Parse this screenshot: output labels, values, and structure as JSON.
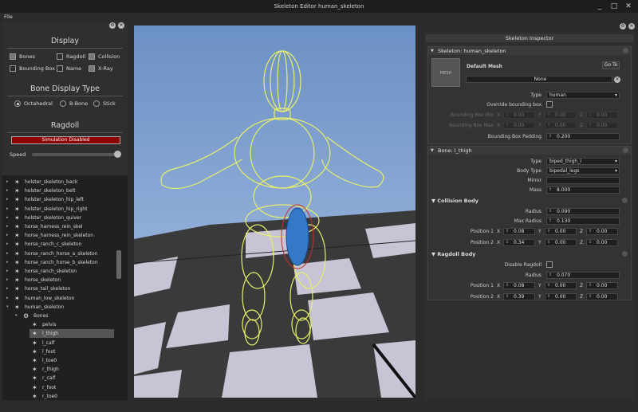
{
  "window": {
    "title": "Skeleton Editor human_skeleton",
    "min": "_",
    "max": "□",
    "close": "✕"
  },
  "menu": {
    "file": "File"
  },
  "display": {
    "heading": "Display",
    "bones": "Bones",
    "ragdoll": "Ragdoll",
    "collision": "Collision",
    "bbox": "Bounding Box",
    "name": "Name",
    "xray": "X-Ray"
  },
  "bone_type": {
    "heading": "Bone Display Type",
    "octahedral": "Octahedral",
    "bbone": "B-Bone",
    "stick": "Stick"
  },
  "ragdoll": {
    "heading": "Ragdoll",
    "sim_button": "Simulation Disabled",
    "speed_label": "Speed",
    "speed_value": 1.0
  },
  "tree": {
    "items": [
      {
        "label": "holster_skeleton_back",
        "depth": 0,
        "exp": "▸"
      },
      {
        "label": "holster_skeleton_belt",
        "depth": 0,
        "exp": "▸"
      },
      {
        "label": "holster_skeleton_hip_left",
        "depth": 0,
        "exp": "▸"
      },
      {
        "label": "holster_skeleton_hip_right",
        "depth": 0,
        "exp": "▸"
      },
      {
        "label": "holster_skeleton_quiver",
        "depth": 0,
        "exp": "▸"
      },
      {
        "label": "horse_harness_rein_skel",
        "depth": 0,
        "exp": "▸"
      },
      {
        "label": "horse_harness_rein_skeleton",
        "depth": 0,
        "exp": "▸"
      },
      {
        "label": "horse_ranch_c_skeleton",
        "depth": 0,
        "exp": "▸"
      },
      {
        "label": "horse_ranch_horse_a_skeleton",
        "depth": 0,
        "exp": "▸"
      },
      {
        "label": "horse_ranch_horse_b_skeleton",
        "depth": 0,
        "exp": "▸"
      },
      {
        "label": "horse_ranch_skeleton",
        "depth": 0,
        "exp": "▸"
      },
      {
        "label": "horse_skeleton",
        "depth": 0,
        "exp": "▸"
      },
      {
        "label": "horse_tail_skeleton",
        "depth": 0,
        "exp": "▸"
      },
      {
        "label": "human_low_skeleton",
        "depth": 0,
        "exp": "▸"
      },
      {
        "label": "human_skeleton",
        "depth": 0,
        "exp": "▾"
      },
      {
        "label": "Bones",
        "depth": 1,
        "exp": "▾"
      },
      {
        "label": "pelvis",
        "depth": 2,
        "exp": ""
      },
      {
        "label": "l_thigh",
        "depth": 2,
        "exp": "",
        "selected": true
      },
      {
        "label": "l_calf",
        "depth": 2,
        "exp": ""
      },
      {
        "label": "l_foot",
        "depth": 2,
        "exp": ""
      },
      {
        "label": "l_toe0",
        "depth": 2,
        "exp": ""
      },
      {
        "label": "r_thigh",
        "depth": 2,
        "exp": ""
      },
      {
        "label": "r_calf",
        "depth": 2,
        "exp": ""
      },
      {
        "label": "r_foot",
        "depth": 2,
        "exp": ""
      },
      {
        "label": "r_toe0",
        "depth": 2,
        "exp": ""
      }
    ]
  },
  "inspector": {
    "title": "Skeleton Inspector",
    "skeleton": {
      "header": "Skeleton: human_skeleton",
      "mesh_label": "Default Mesh",
      "goto": "Go To",
      "thumb": "MESH",
      "none": "None",
      "type_label": "Type",
      "type_value": "human",
      "override_label": "Override bounding box",
      "bbmin_label": "Bounding Box Min",
      "bbmax_label": "Bounding Box Max",
      "bbmin": [
        "0.00",
        "0.00",
        "0.00"
      ],
      "bbmax": [
        "0.00",
        "0.00",
        "0.00"
      ],
      "padding_label": "Bounding Box Padding",
      "padding": "0.200"
    },
    "bone": {
      "header": "Bone: l_thigh",
      "type_label": "Type",
      "type_value": "biped_thigh_l",
      "btype_label": "Body Type",
      "btype_value": "bipedal_legs",
      "mirror_label": "Mirror",
      "mass_label": "Mass",
      "mass": "8.000"
    },
    "collision": {
      "header": "Collision Body",
      "radius_label": "Radius",
      "radius": "0.090",
      "maxr_label": "Max Radius",
      "maxr": "0.130",
      "p1_label": "Position 1",
      "p1": [
        "0.08",
        "0.00",
        "0.00"
      ],
      "p2_label": "Position 2",
      "p2": [
        "0.34",
        "0.00",
        "0.00"
      ]
    },
    "ragdollbody": {
      "header": "Ragdoll Body",
      "disable_label": "Disable Ragdoll",
      "radius_label": "Radius",
      "radius": "0.070",
      "p1_label": "Position 1",
      "p1": [
        "0.08",
        "0.00",
        "0.00"
      ],
      "p2_label": "Position 2",
      "p2": [
        "0.39",
        "0.00",
        "0.00"
      ]
    },
    "axes": [
      "X",
      "Y",
      "Z"
    ]
  }
}
